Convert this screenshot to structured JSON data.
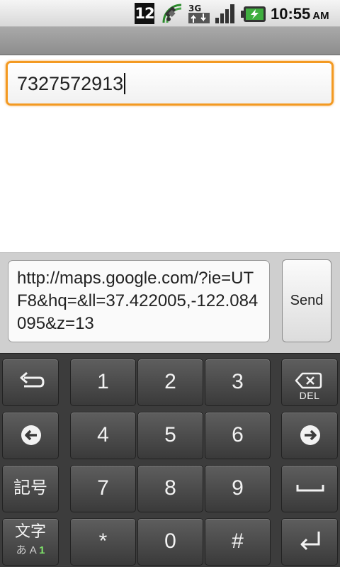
{
  "status_bar": {
    "notification_count": "12",
    "time": "10:55",
    "ampm": "AM",
    "network_type": "3G",
    "icons": [
      "gps-satellite-icon",
      "3g-data-icon",
      "signal-strength-icon",
      "battery-charging-icon"
    ]
  },
  "compose": {
    "recipient_value": "7327572913",
    "message_value": "http://maps.google.com/?ie=UTF8&hq=&ll=37.422005,-122.084095&z=13",
    "send_label": "Send"
  },
  "keyboard": {
    "digit_keys": [
      "1",
      "2",
      "3",
      "4",
      "5",
      "6",
      "7",
      "8",
      "9",
      "*",
      "0",
      "#"
    ],
    "del_label": "DEL",
    "symbols_label": "記号",
    "mode_label_top": "文字",
    "mode_label_kana": "あ A ",
    "mode_label_num": "1"
  },
  "colors": {
    "focus_border": "#f39a22",
    "keyboard_bg": "#3c3c3c",
    "key_text": "#f2f2f2"
  }
}
